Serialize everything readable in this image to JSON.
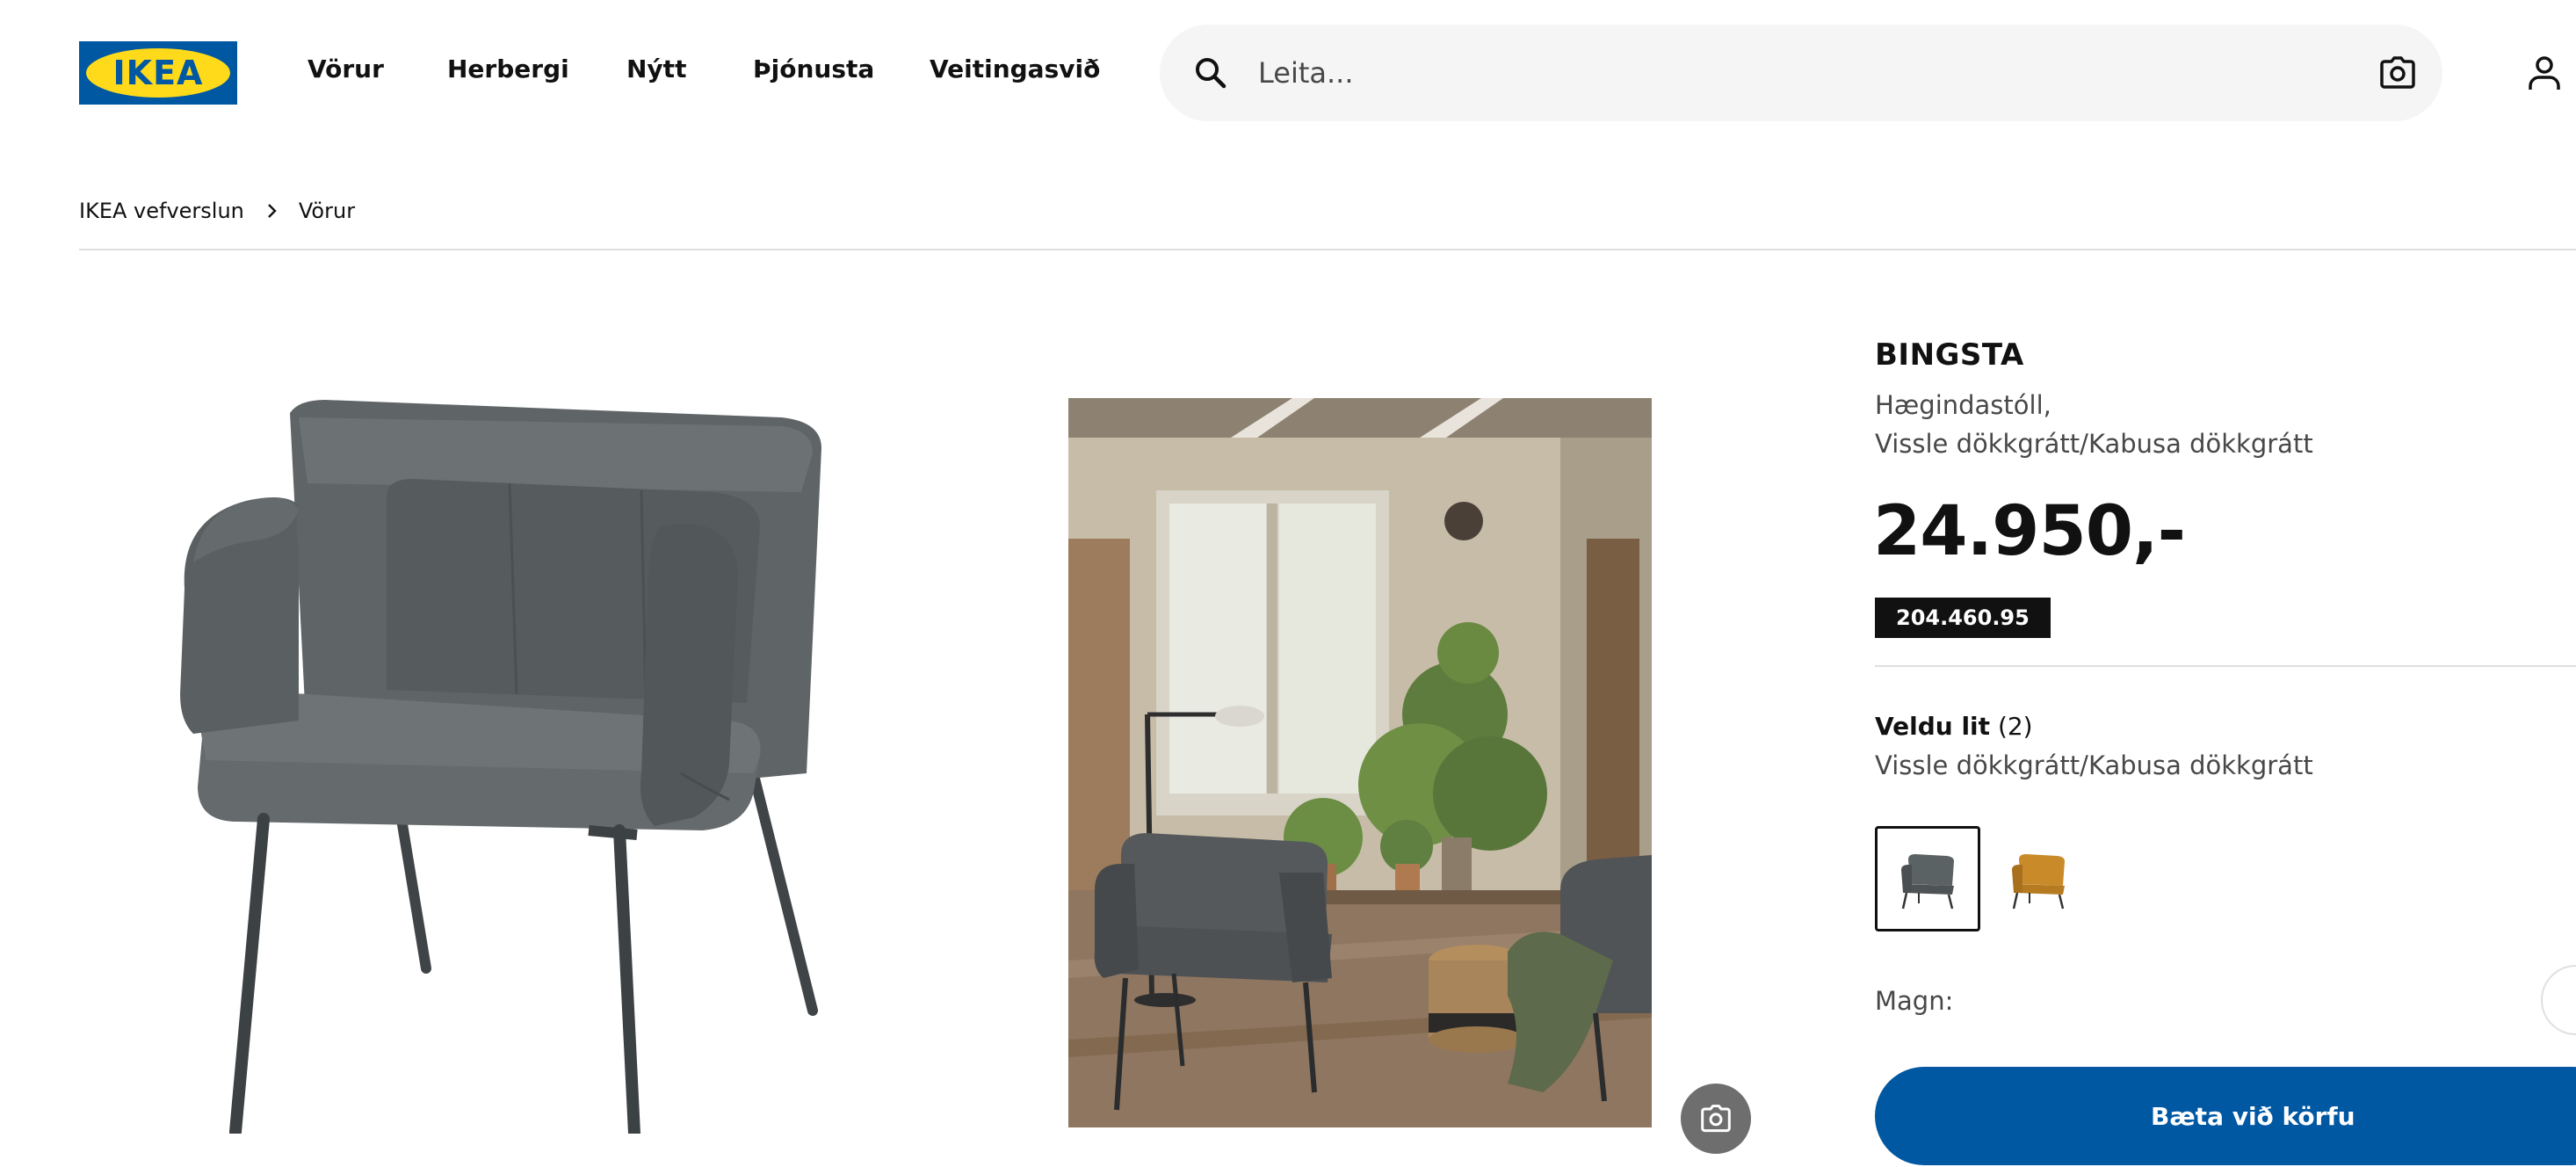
{
  "brand": {
    "logo_text": "IKEA",
    "primary_color": "#0058a3",
    "logo_yellow": "#ffda1a"
  },
  "nav": {
    "items": [
      {
        "label": "Vörur"
      },
      {
        "label": "Herbergi"
      },
      {
        "label": "Nýtt"
      },
      {
        "label": "Þjónusta"
      },
      {
        "label": "Veitingasvið"
      }
    ]
  },
  "search": {
    "placeholder": "Leita...",
    "icon": "search-icon",
    "camera_icon": "camera-icon"
  },
  "account": {
    "icon": "user-icon"
  },
  "breadcrumb": [
    {
      "label": "IKEA vefverslun"
    },
    {
      "label": "Vörur"
    }
  ],
  "media": {
    "camera_icon": "camera-icon"
  },
  "product": {
    "name": "BINGSTA",
    "type": "Hægindastóll,",
    "variant": "Vissle dökkgrátt/Kabusa dökkgrátt",
    "price": "24.950,-",
    "article_number": "204.460.95",
    "color_heading": "Veldu lit",
    "color_count": "(2)",
    "selected_color": "Vissle dökkgrátt/Kabusa dökkgrátt",
    "swatches": [
      {
        "color": "#5b6264",
        "selected": true
      },
      {
        "color": "#c98a2a",
        "selected": false
      }
    ],
    "quantity_label": "Magn:",
    "add_to_cart": "Bæta við körfu"
  }
}
